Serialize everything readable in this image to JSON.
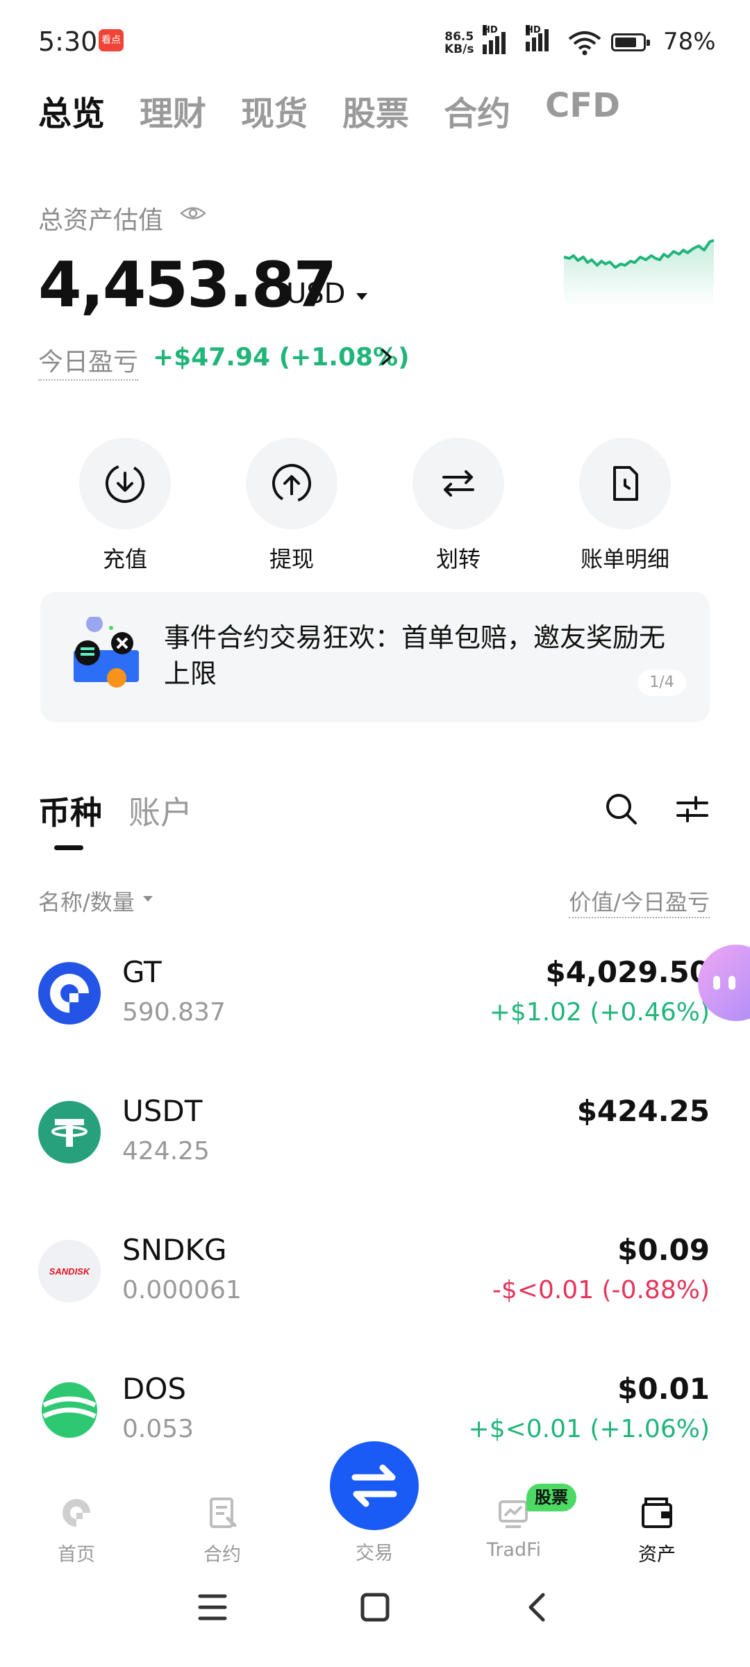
{
  "status_bar": {
    "time": "5:30",
    "app_badge": "看点",
    "net_speed_value": "86.5",
    "net_speed_unit": "KB/s",
    "hd1": "HD",
    "hd2": "HD",
    "battery": "78%"
  },
  "top_tabs": [
    "总览",
    "理财",
    "现货",
    "股票",
    "合约",
    "CFD"
  ],
  "asset": {
    "label": "总资产估值",
    "total": "4,453.87",
    "currency": "USD",
    "pnl_label": "今日盈亏",
    "pnl_value": "+$47.94 (+1.08%)"
  },
  "actions": [
    {
      "label": "充值",
      "icon": "deposit-icon"
    },
    {
      "label": "提现",
      "icon": "withdraw-icon"
    },
    {
      "label": "划转",
      "icon": "transfer-icon"
    },
    {
      "label": "账单明细",
      "icon": "bill-icon"
    }
  ],
  "banner": {
    "text": "事件合约交易狂欢：首单包赔，邀友奖励无上限",
    "page": "1/4"
  },
  "list_tabs": {
    "coins": "币种",
    "accounts": "账户"
  },
  "columns": {
    "left": "名称/数量",
    "right": "价值/今日盈亏"
  },
  "coins": [
    {
      "name": "GT",
      "qty": "590.837",
      "value": "$4,029.50",
      "pnl": "+$1.02 (+0.46%)",
      "trend": "up"
    },
    {
      "name": "USDT",
      "qty": "424.25",
      "value": "$424.25",
      "pnl": "",
      "trend": "flat"
    },
    {
      "name": "SNDKG",
      "qty": "0.000061",
      "value": "$0.09",
      "pnl": "-$<0.01 (-0.88%)",
      "trend": "down"
    },
    {
      "name": "DOS",
      "qty": "0.053",
      "value": "$0.01",
      "pnl": "+$<0.01 (+1.06%)",
      "trend": "up"
    }
  ],
  "coin_logo_text": {
    "sndkg": "SANDISK"
  },
  "bottom_nav": {
    "home": "首页",
    "futures": "合约",
    "trade": "交易",
    "tradfi": "TradFi",
    "tradfi_badge": "股票",
    "assets": "资产"
  },
  "colors": {
    "up": "#21b57a",
    "down": "#e5345a",
    "accent": "#1a5af5"
  }
}
